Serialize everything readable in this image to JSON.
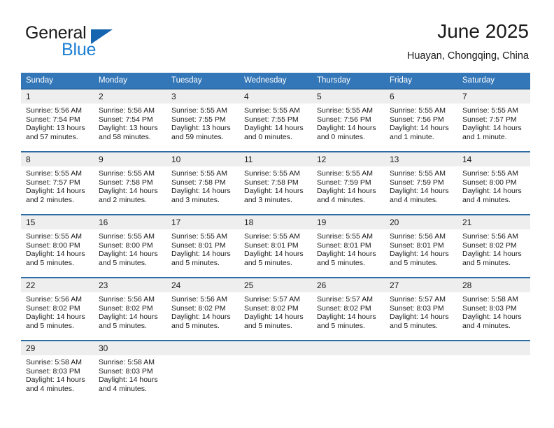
{
  "brand": {
    "name_part1": "General",
    "name_part2": "Blue",
    "accent_color": "#1c7fd4",
    "triangle_color": "#1565b0"
  },
  "header": {
    "title": "June 2025",
    "location": "Huayan, Chongqing, China"
  },
  "theme": {
    "header_row_bg": "#3477b8",
    "rule_color": "#2e6da4",
    "daynum_bg": "#eeeeee"
  },
  "weekday_headers": [
    "Sunday",
    "Monday",
    "Tuesday",
    "Wednesday",
    "Thursday",
    "Friday",
    "Saturday"
  ],
  "weeks": [
    [
      {
        "day": "1",
        "sunrise": "Sunrise: 5:56 AM",
        "sunset": "Sunset: 7:54 PM",
        "daylight1": "Daylight: 13 hours",
        "daylight2": "and 57 minutes."
      },
      {
        "day": "2",
        "sunrise": "Sunrise: 5:56 AM",
        "sunset": "Sunset: 7:54 PM",
        "daylight1": "Daylight: 13 hours",
        "daylight2": "and 58 minutes."
      },
      {
        "day": "3",
        "sunrise": "Sunrise: 5:55 AM",
        "sunset": "Sunset: 7:55 PM",
        "daylight1": "Daylight: 13 hours",
        "daylight2": "and 59 minutes."
      },
      {
        "day": "4",
        "sunrise": "Sunrise: 5:55 AM",
        "sunset": "Sunset: 7:55 PM",
        "daylight1": "Daylight: 14 hours",
        "daylight2": "and 0 minutes."
      },
      {
        "day": "5",
        "sunrise": "Sunrise: 5:55 AM",
        "sunset": "Sunset: 7:56 PM",
        "daylight1": "Daylight: 14 hours",
        "daylight2": "and 0 minutes."
      },
      {
        "day": "6",
        "sunrise": "Sunrise: 5:55 AM",
        "sunset": "Sunset: 7:56 PM",
        "daylight1": "Daylight: 14 hours",
        "daylight2": "and 1 minute."
      },
      {
        "day": "7",
        "sunrise": "Sunrise: 5:55 AM",
        "sunset": "Sunset: 7:57 PM",
        "daylight1": "Daylight: 14 hours",
        "daylight2": "and 1 minute."
      }
    ],
    [
      {
        "day": "8",
        "sunrise": "Sunrise: 5:55 AM",
        "sunset": "Sunset: 7:57 PM",
        "daylight1": "Daylight: 14 hours",
        "daylight2": "and 2 minutes."
      },
      {
        "day": "9",
        "sunrise": "Sunrise: 5:55 AM",
        "sunset": "Sunset: 7:58 PM",
        "daylight1": "Daylight: 14 hours",
        "daylight2": "and 2 minutes."
      },
      {
        "day": "10",
        "sunrise": "Sunrise: 5:55 AM",
        "sunset": "Sunset: 7:58 PM",
        "daylight1": "Daylight: 14 hours",
        "daylight2": "and 3 minutes."
      },
      {
        "day": "11",
        "sunrise": "Sunrise: 5:55 AM",
        "sunset": "Sunset: 7:58 PM",
        "daylight1": "Daylight: 14 hours",
        "daylight2": "and 3 minutes."
      },
      {
        "day": "12",
        "sunrise": "Sunrise: 5:55 AM",
        "sunset": "Sunset: 7:59 PM",
        "daylight1": "Daylight: 14 hours",
        "daylight2": "and 4 minutes."
      },
      {
        "day": "13",
        "sunrise": "Sunrise: 5:55 AM",
        "sunset": "Sunset: 7:59 PM",
        "daylight1": "Daylight: 14 hours",
        "daylight2": "and 4 minutes."
      },
      {
        "day": "14",
        "sunrise": "Sunrise: 5:55 AM",
        "sunset": "Sunset: 8:00 PM",
        "daylight1": "Daylight: 14 hours",
        "daylight2": "and 4 minutes."
      }
    ],
    [
      {
        "day": "15",
        "sunrise": "Sunrise: 5:55 AM",
        "sunset": "Sunset: 8:00 PM",
        "daylight1": "Daylight: 14 hours",
        "daylight2": "and 5 minutes."
      },
      {
        "day": "16",
        "sunrise": "Sunrise: 5:55 AM",
        "sunset": "Sunset: 8:00 PM",
        "daylight1": "Daylight: 14 hours",
        "daylight2": "and 5 minutes."
      },
      {
        "day": "17",
        "sunrise": "Sunrise: 5:55 AM",
        "sunset": "Sunset: 8:01 PM",
        "daylight1": "Daylight: 14 hours",
        "daylight2": "and 5 minutes."
      },
      {
        "day": "18",
        "sunrise": "Sunrise: 5:55 AM",
        "sunset": "Sunset: 8:01 PM",
        "daylight1": "Daylight: 14 hours",
        "daylight2": "and 5 minutes."
      },
      {
        "day": "19",
        "sunrise": "Sunrise: 5:55 AM",
        "sunset": "Sunset: 8:01 PM",
        "daylight1": "Daylight: 14 hours",
        "daylight2": "and 5 minutes."
      },
      {
        "day": "20",
        "sunrise": "Sunrise: 5:56 AM",
        "sunset": "Sunset: 8:01 PM",
        "daylight1": "Daylight: 14 hours",
        "daylight2": "and 5 minutes."
      },
      {
        "day": "21",
        "sunrise": "Sunrise: 5:56 AM",
        "sunset": "Sunset: 8:02 PM",
        "daylight1": "Daylight: 14 hours",
        "daylight2": "and 5 minutes."
      }
    ],
    [
      {
        "day": "22",
        "sunrise": "Sunrise: 5:56 AM",
        "sunset": "Sunset: 8:02 PM",
        "daylight1": "Daylight: 14 hours",
        "daylight2": "and 5 minutes."
      },
      {
        "day": "23",
        "sunrise": "Sunrise: 5:56 AM",
        "sunset": "Sunset: 8:02 PM",
        "daylight1": "Daylight: 14 hours",
        "daylight2": "and 5 minutes."
      },
      {
        "day": "24",
        "sunrise": "Sunrise: 5:56 AM",
        "sunset": "Sunset: 8:02 PM",
        "daylight1": "Daylight: 14 hours",
        "daylight2": "and 5 minutes."
      },
      {
        "day": "25",
        "sunrise": "Sunrise: 5:57 AM",
        "sunset": "Sunset: 8:02 PM",
        "daylight1": "Daylight: 14 hours",
        "daylight2": "and 5 minutes."
      },
      {
        "day": "26",
        "sunrise": "Sunrise: 5:57 AM",
        "sunset": "Sunset: 8:02 PM",
        "daylight1": "Daylight: 14 hours",
        "daylight2": "and 5 minutes."
      },
      {
        "day": "27",
        "sunrise": "Sunrise: 5:57 AM",
        "sunset": "Sunset: 8:03 PM",
        "daylight1": "Daylight: 14 hours",
        "daylight2": "and 5 minutes."
      },
      {
        "day": "28",
        "sunrise": "Sunrise: 5:58 AM",
        "sunset": "Sunset: 8:03 PM",
        "daylight1": "Daylight: 14 hours",
        "daylight2": "and 4 minutes."
      }
    ],
    [
      {
        "day": "29",
        "sunrise": "Sunrise: 5:58 AM",
        "sunset": "Sunset: 8:03 PM",
        "daylight1": "Daylight: 14 hours",
        "daylight2": "and 4 minutes."
      },
      {
        "day": "30",
        "sunrise": "Sunrise: 5:58 AM",
        "sunset": "Sunset: 8:03 PM",
        "daylight1": "Daylight: 14 hours",
        "daylight2": "and 4 minutes."
      },
      null,
      null,
      null,
      null,
      null
    ]
  ]
}
